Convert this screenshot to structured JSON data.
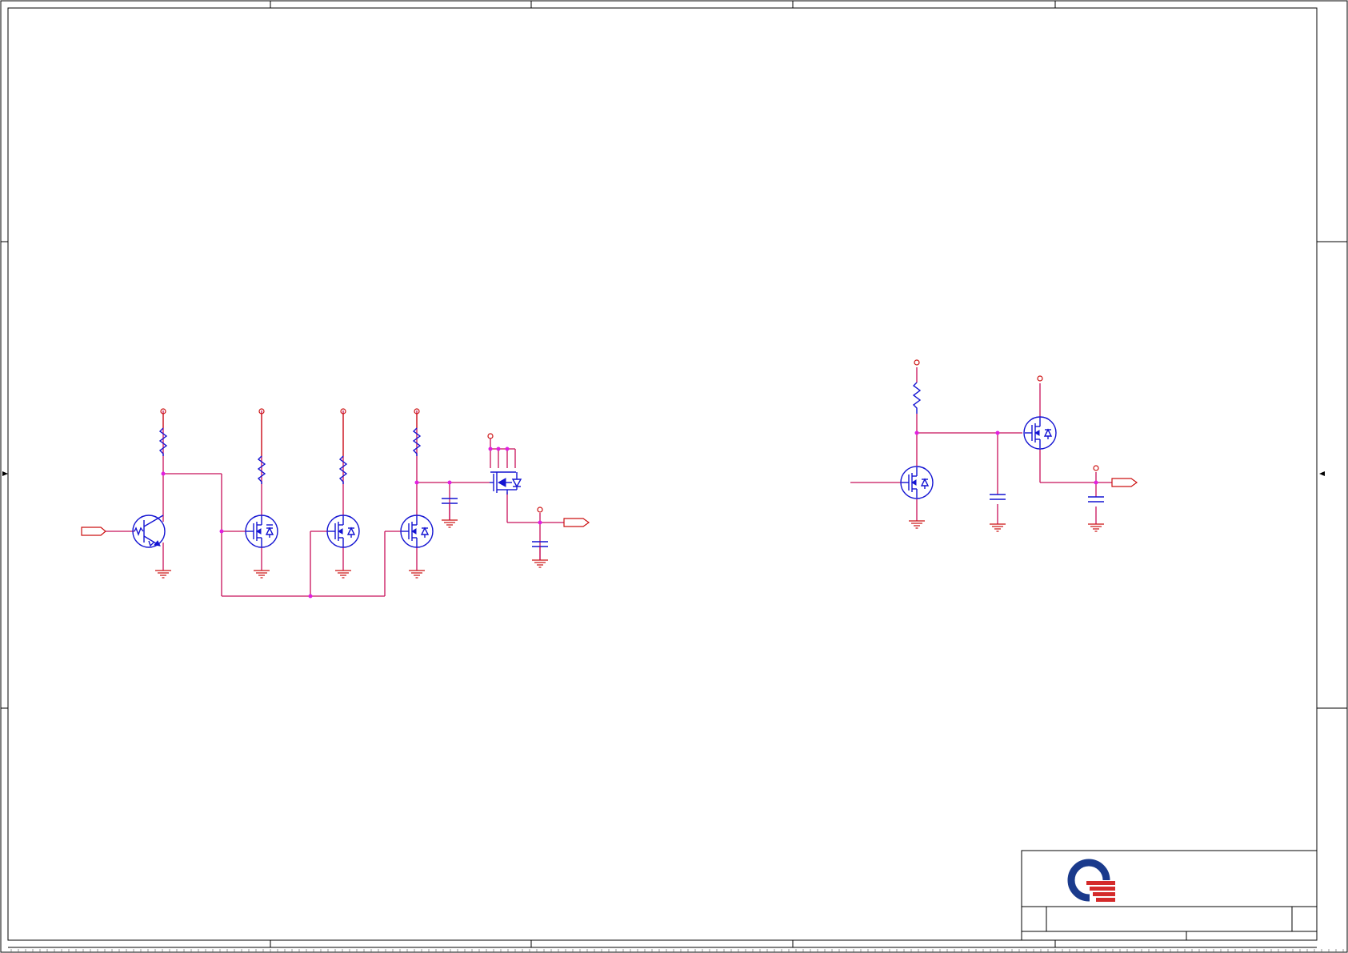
{
  "sheet": {
    "border_color": "#000000",
    "wire_color": "#c8105a",
    "component_color": "#1414d2",
    "power_color": "#cc1111",
    "junction_color": "#e020e0"
  },
  "logo": {
    "name": "company-logo",
    "ring_color": "#1a3a8c",
    "stripe_color": "#d42a2a"
  },
  "components": [
    {
      "type": "npn-transistor",
      "name": "input-transistor"
    },
    {
      "type": "n-mosfet",
      "name": "mosfet-stage-1"
    },
    {
      "type": "n-mosfet",
      "name": "mosfet-stage-2"
    },
    {
      "type": "n-mosfet",
      "name": "mosfet-stage-3"
    },
    {
      "type": "p-mosfet",
      "name": "output-switch"
    },
    {
      "type": "n-mosfet",
      "name": "right-input-mosfet"
    },
    {
      "type": "n-mosfet",
      "name": "right-output-mosfet"
    }
  ]
}
